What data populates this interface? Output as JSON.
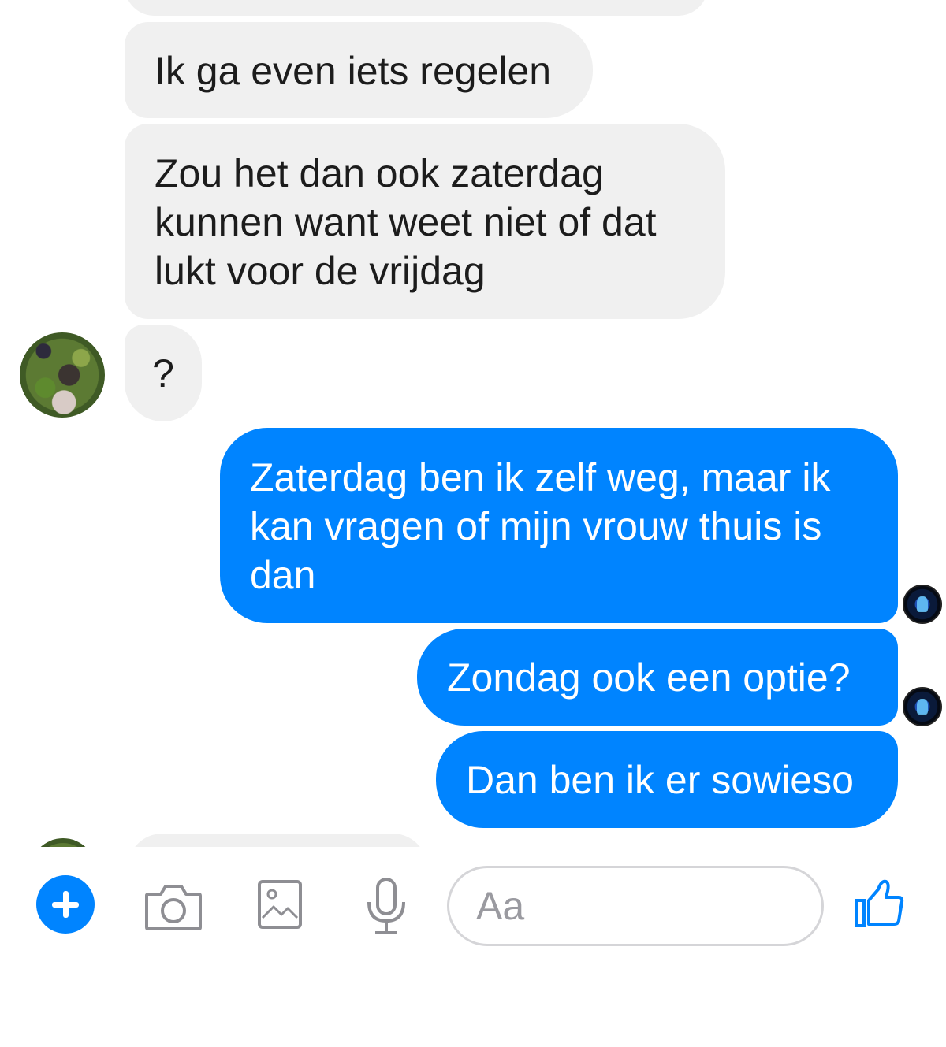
{
  "messages": [
    {
      "direction": "in",
      "text": "Ik ga even iets regelen"
    },
    {
      "direction": "in",
      "text": "Zou het dan ook zaterdag\nkunnen want weet niet of dat\nlukt voor de vrijdag"
    },
    {
      "direction": "in",
      "text": "?"
    },
    {
      "direction": "out",
      "text": "Zaterdag ben ik zelf weg, maar ik\nkan vragen of mijn vrouw thuis is\ndan"
    },
    {
      "direction": "out",
      "text": "Zondag ook een optie?"
    },
    {
      "direction": "out",
      "text": "Dan ben ik er sowieso"
    }
  ],
  "composer": {
    "placeholder": "Aa",
    "icons": [
      "plus-icon",
      "camera-icon",
      "image-icon",
      "microphone-icon",
      "thumbs-up-icon"
    ]
  },
  "colors": {
    "outgoing_bubble": "#0084ff",
    "incoming_bubble": "#f0f0f0",
    "incoming_text": "#1c1c1c",
    "icon_gray": "#8e8e93",
    "accent": "#0084ff"
  }
}
